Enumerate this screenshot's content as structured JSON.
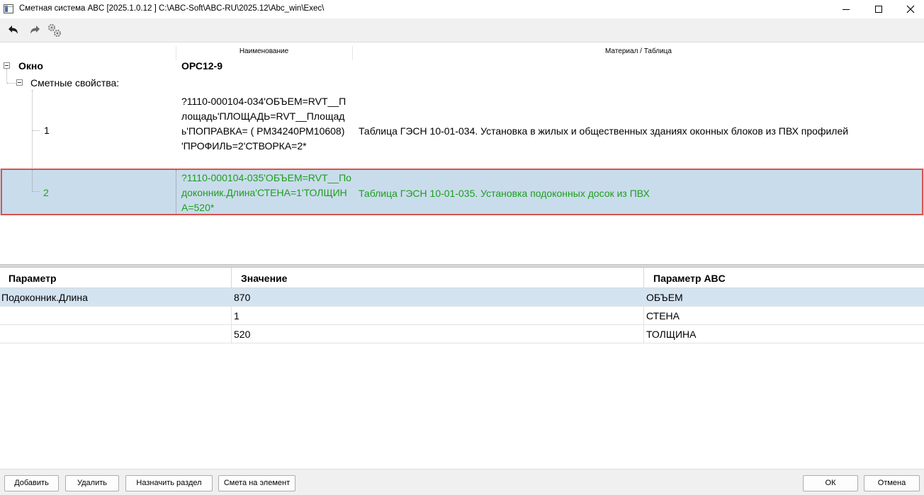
{
  "window": {
    "title": "Сметная система ABC [2025.1.0.12 ]   C:\\ABC-Soft\\ABC-RU\\2025.12\\Abc_win\\Exec\\"
  },
  "toolbar": {
    "icons": [
      "undo-icon",
      "redo-icon",
      "settings-gears-icon"
    ]
  },
  "tree": {
    "columns": {
      "name": "Наименование",
      "material": "Материал / Таблица"
    },
    "root": {
      "label": "Окно",
      "name": "ОРС12-9"
    },
    "group": {
      "label": "Сметные свойства:"
    },
    "rows": [
      {
        "index": "1",
        "name": "?1110-000104-034'ОБЪЕМ=RVT__Площадь'ПЛОЩАДЬ=RVT__Площадь'ПОПРАВКА= ( РМ34240РМ10608)  'ПРОФИЛЬ=2'СТВОРКА=2*",
        "material": "Таблица ГЭСН 10-01-034. Установка в жилых и общественных зданиях оконных блоков из ПВХ профилей"
      },
      {
        "index": "2",
        "name": "?1110-000104-035'ОБЪЕМ=RVT__Подоконник.Длина'СТЕНА=1'ТОЛЩИНА=520*",
        "material": "Таблица ГЭСН 10-01-035. Установка подоконных досок из ПВХ"
      }
    ]
  },
  "params": {
    "headers": [
      "Параметр",
      "Значение",
      "Параметр ABC"
    ],
    "rows": [
      {
        "param": "Подоконник.Длина",
        "value": "870",
        "abc": "ОБЪЕМ"
      },
      {
        "param": "",
        "value": "1",
        "abc": "СТЕНА"
      },
      {
        "param": "",
        "value": "520",
        "abc": "ТОЛЩИНА"
      }
    ]
  },
  "buttons": {
    "add": "Добавить",
    "delete": "Удалить",
    "assign_section": "Назначить раздел",
    "estimate": "Смета на элемент",
    "ok": "ОК",
    "cancel": "Отмена"
  },
  "colors": {
    "selected_row": "#c9dcec",
    "selected_text": "#1e9e1e",
    "highlight_border": "#d9534f"
  }
}
